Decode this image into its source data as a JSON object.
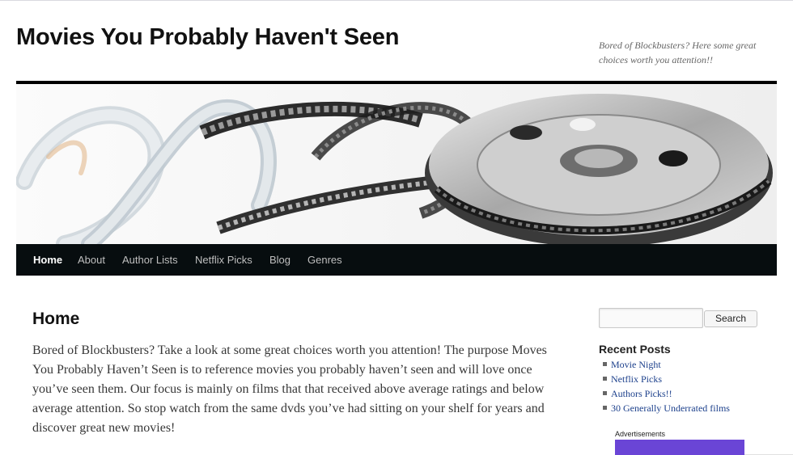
{
  "site": {
    "title": "Movies You Probably Haven't Seen",
    "tagline": "Bored of Blockbusters? Here some great choices worth you attention!!"
  },
  "banner": {
    "icon": "film-reel-image"
  },
  "nav": {
    "items": [
      {
        "label": "Home",
        "active": true
      },
      {
        "label": "About",
        "active": false
      },
      {
        "label": "Author Lists",
        "active": false
      },
      {
        "label": "Netflix Picks",
        "active": false
      },
      {
        "label": "Blog",
        "active": false
      },
      {
        "label": "Genres",
        "active": false
      }
    ]
  },
  "page": {
    "title": "Home",
    "body": "Bored of Blockbusters? Take a look at some great choices worth you attention! The purpose Moves You Probably Haven’t Seen is to reference movies you probably haven’t seen and will love once you’ve seen them. Our focus is mainly on films that that received above average ratings and below average attention. So stop watch from the same dvds you’ve had sitting on your shelf for years and discover great new movies!"
  },
  "sidebar": {
    "search": {
      "value": "",
      "button_label": "Search"
    },
    "recent_posts": {
      "title": "Recent Posts",
      "items": [
        "Movie Night",
        "Netflix Picks",
        "Authors Picks!!",
        "30 Generally Underrated films"
      ]
    },
    "ads_label": "Advertisements"
  },
  "colors": {
    "nav_bg": "#070d0f",
    "link": "#1b3f8b",
    "ad_accent": "#6a45d6"
  }
}
